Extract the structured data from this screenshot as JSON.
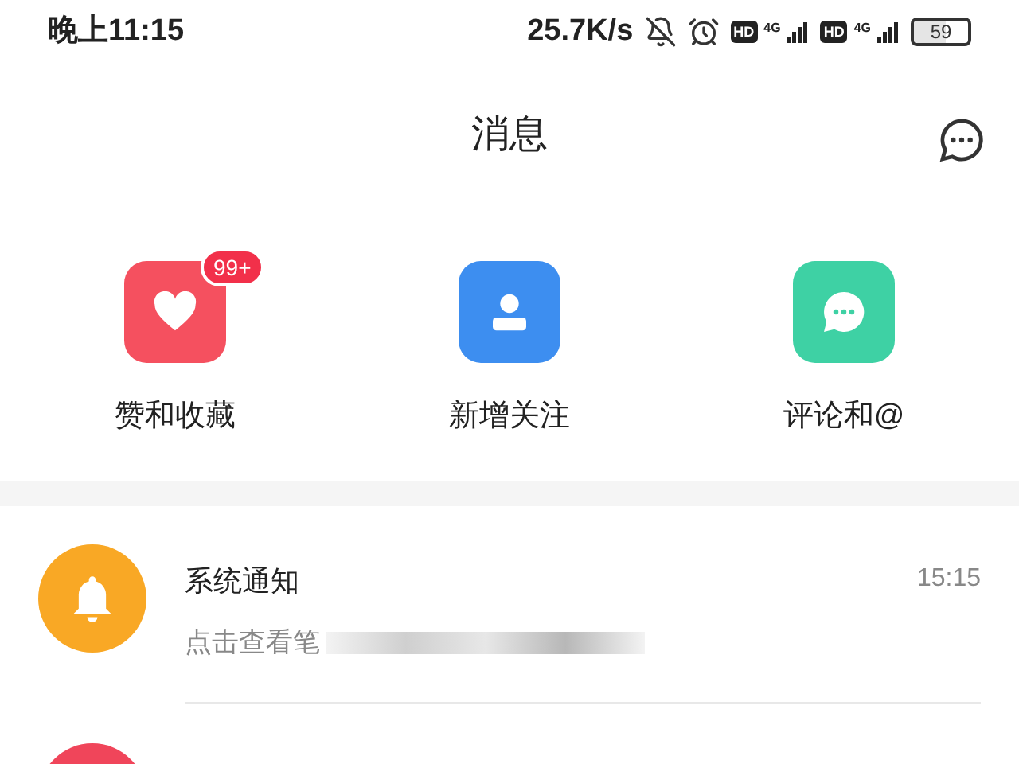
{
  "status_bar": {
    "time": "晚上11:15",
    "speed": "25.7K/s",
    "sims": [
      {
        "hd": "HD",
        "network": "4G"
      },
      {
        "hd": "HD",
        "network": "4G"
      }
    ],
    "battery": "59"
  },
  "header": {
    "title": "消息"
  },
  "shortcuts": [
    {
      "kind": "heart",
      "label": "赞和收藏",
      "badge": "99+",
      "color": "#f5505f"
    },
    {
      "kind": "person",
      "label": "新增关注",
      "color": "#3d8ef0"
    },
    {
      "kind": "chat",
      "label": "评论和@",
      "color": "#3ed1a4"
    }
  ],
  "messages": [
    {
      "kind": "bell",
      "title": "系统通知",
      "subtitle": "点击查看笔",
      "time": "15:15",
      "color": "#f9a825"
    },
    {
      "kind": "unknown",
      "color": "#f0455a"
    }
  ]
}
